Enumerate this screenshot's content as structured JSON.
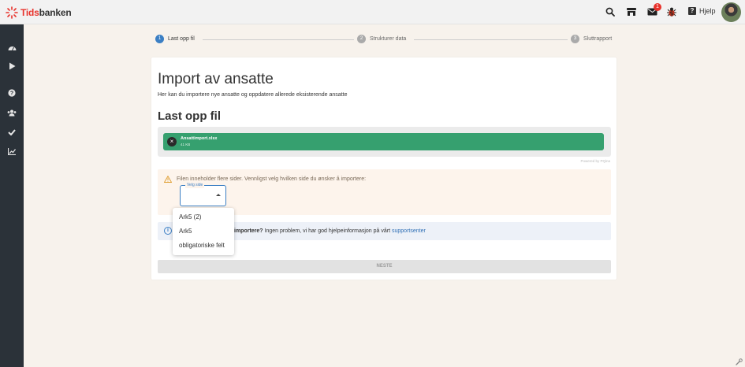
{
  "app": {
    "brand_part1": "Tids",
    "brand_part2": "banken",
    "notification_count": "1",
    "help_label": "Hjelp"
  },
  "icons": {
    "topbar": [
      "search-icon",
      "store-icon",
      "mail-icon",
      "bug-icon",
      "help-icon"
    ],
    "sidebar": [
      "dashboard-icon",
      "play-icon",
      "question-icon",
      "users-icon",
      "check-icon",
      "chart-icon"
    ]
  },
  "steps": [
    {
      "num": "1",
      "label": "Last opp fil",
      "active": true
    },
    {
      "num": "2",
      "label": "Strukturer data",
      "active": false
    },
    {
      "num": "3",
      "label": "Sluttrapport",
      "active": false
    }
  ],
  "page": {
    "title": "Import av ansatte",
    "subtitle": "Her kan du importere nye ansatte og oppdatere allerede eksisterende ansatte",
    "section_title": "Last opp fil"
  },
  "file": {
    "name": "Ansattimport.xlsx",
    "size": "41 KB",
    "powered_by": "Powered by PQina"
  },
  "sheet_select": {
    "warning": "Filen inneholder flere sider. Vennligst velg hvilken side du ønsker å importere:",
    "label": "Velg side",
    "options": [
      "Ark5 (2)",
      "Ark5",
      "obligatoriske felt"
    ]
  },
  "info": {
    "bold": "importere?",
    "text": " Ingen problem, vi har god hjelpeinformasjon på vårt ",
    "link": "supportsenter"
  },
  "next_button": "NESTE",
  "colors": {
    "accent": "#3b7fc4",
    "brand_red": "#e8322b",
    "file_green": "#36a06f",
    "sidebar": "#2b3239"
  }
}
